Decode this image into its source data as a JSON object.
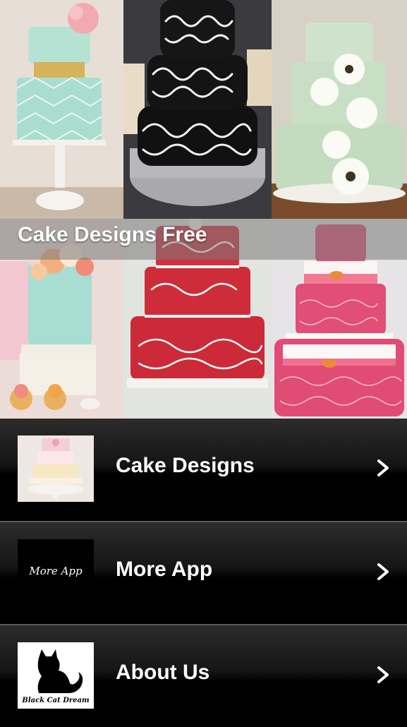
{
  "app": {
    "title": "Cake Designs Free"
  },
  "hero": {
    "images": [
      {
        "name": "mint-lattice-cake-photo"
      },
      {
        "name": "black-scroll-cake-photo"
      },
      {
        "name": "green-flower-cake-photo"
      },
      {
        "name": "mint-floral-cake-photo"
      },
      {
        "name": "red-floral-cake-photo"
      },
      {
        "name": "pink-paisley-cake-photo"
      }
    ]
  },
  "menu": {
    "items": [
      {
        "label": "Cake Designs",
        "icon": "cake-thumbnail"
      },
      {
        "label": "More App",
        "icon": "more-app-logo",
        "logo_text": "More App"
      },
      {
        "label": "About Us",
        "icon": "black-cat-logo",
        "logo_text": "Black Cat Dream"
      }
    ]
  },
  "colors": {
    "menu_bg": "#000000",
    "text": "#ffffff",
    "separator": "#5a5a5a"
  }
}
